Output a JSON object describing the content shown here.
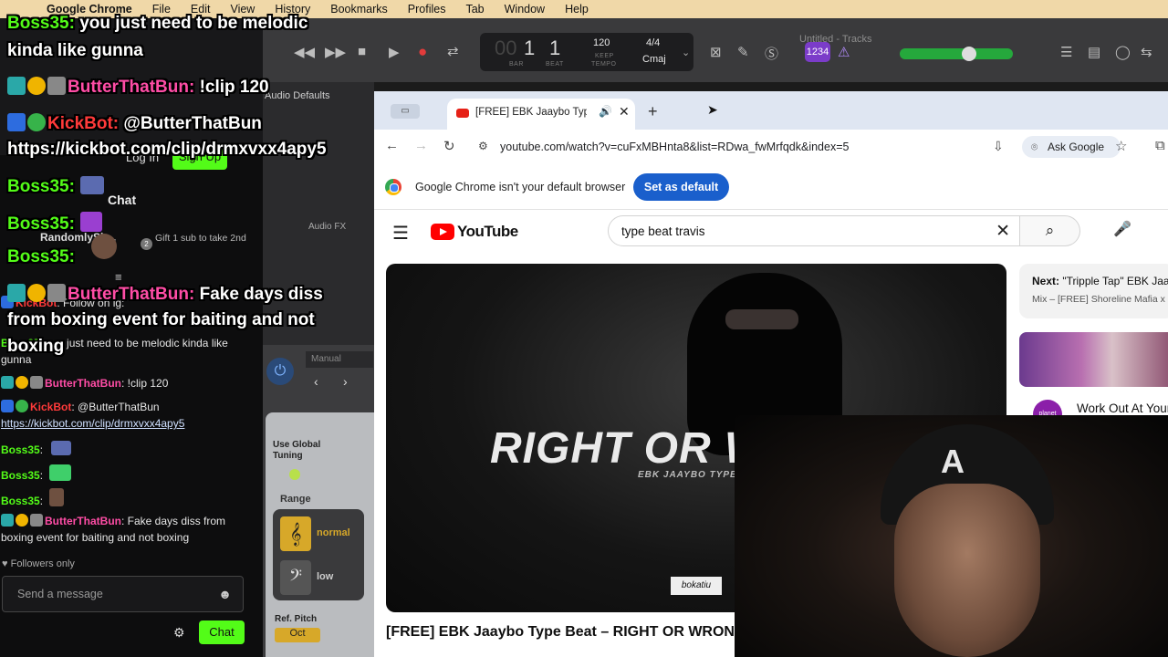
{
  "menubar": {
    "items": [
      "Google Chrome",
      "File",
      "Edit",
      "View",
      "History",
      "Bookmarks",
      "Profiles",
      "Tab",
      "Window",
      "Help"
    ]
  },
  "logic": {
    "window_title": "Untitled - Tracks",
    "lcd": {
      "bar": "1",
      "beat": "1",
      "bar_label": "BAR",
      "beat_label": "BEAT",
      "tempo": "120",
      "keep": "KEEP",
      "tempo_label": "TEMPO",
      "sig": "4/4",
      "key": "Cmaj"
    },
    "badge": "1234",
    "audio_defaults": "Audio Defaults",
    "audio_fx": "Audio FX",
    "manual": "Manual",
    "use_global_tuning": "Use Global Tuning",
    "range": "Range",
    "normal": "normal",
    "low": "low",
    "ref_pitch": "Ref. Pitch",
    "oct": "Oct"
  },
  "chrome": {
    "tab_title": "[FREE] EBK Jaaybo Type B",
    "url": "youtube.com/watch?v=cuFxMBHnta8&list=RDwa_fwMrfqdk&index=5",
    "ask_google": "Ask Google",
    "infobar_msg": "Google Chrome isn't your default browser",
    "set_default": "Set as default"
  },
  "youtube": {
    "logo_text": "YouTube",
    "search_query": "type beat travis",
    "video_big_text": "RIGHT OR W",
    "video_sub_text": "EBK JAAYBO TYPE B",
    "video_brand": "bokatiu",
    "video_title": "[FREE] EBK Jaaybo Type Beat – RIGHT OR WRON",
    "next_label": "Next:",
    "next_title": "\"Tripple Tap\" EBK Jaa",
    "next_sub": "Mix – [FREE] Shoreline Mafia x C",
    "ad_icon_text": "planet",
    "ad_title": "Work Out At Your"
  },
  "chat": {
    "login": "Log In",
    "signup": "Sign Up",
    "header": "Chat",
    "pinned_user": "RandomlySh...",
    "gift_count": "2",
    "gift_text": "Gift 1 sub to take 2nd",
    "messages": [
      {
        "user": "KickBot",
        "text": ": Follow on ig:"
      },
      {
        "user": "Boss35",
        "text": ": you just need to be melodic kinda like gunna"
      },
      {
        "user": "ButterThatBun",
        "text": ": !clip 120"
      },
      {
        "user": "KickBot",
        "text": ": @ButterThatBun"
      },
      {
        "link": "https://kickbot.com/clip/drmxvxx4apy5"
      },
      {
        "user": "Boss35",
        "text": ":"
      },
      {
        "user": "Boss35",
        "text": ":"
      },
      {
        "user": "Boss35",
        "text": ":"
      },
      {
        "user": "ButterThatBun",
        "text": ": Fake days diss from boxing event for baiting and not boxing"
      }
    ],
    "followers_only": "Followers only",
    "input_placeholder": "Send a message",
    "send_button": "Chat"
  },
  "overlay": {
    "line1_user": "Boss35:",
    "line1_text": " you just need to be melodic",
    "line2_text": "kinda like gunna",
    "line3_user": "ButterThatBun:",
    "line3_text": " !clip 120",
    "line4_user": "KickBot:",
    "line4_text": " @ButterThatBun",
    "line5_text": "https://kickbot.com/clip/drmxvxx4apy5",
    "line6_user": "Boss35:",
    "line7_user": "Boss35:",
    "line8_user": "Boss35:",
    "line9_user": "ButterThatBun:",
    "line9_text": " Fake days diss",
    "line10_text": "from boxing event for baiting and not",
    "line11_text": "boxing"
  },
  "colors": {
    "kick_green": "#53fc18",
    "kickbot_red": "#ff3a3a",
    "butter_pink": "#ff4da6",
    "boss_green": "#53fc18"
  }
}
